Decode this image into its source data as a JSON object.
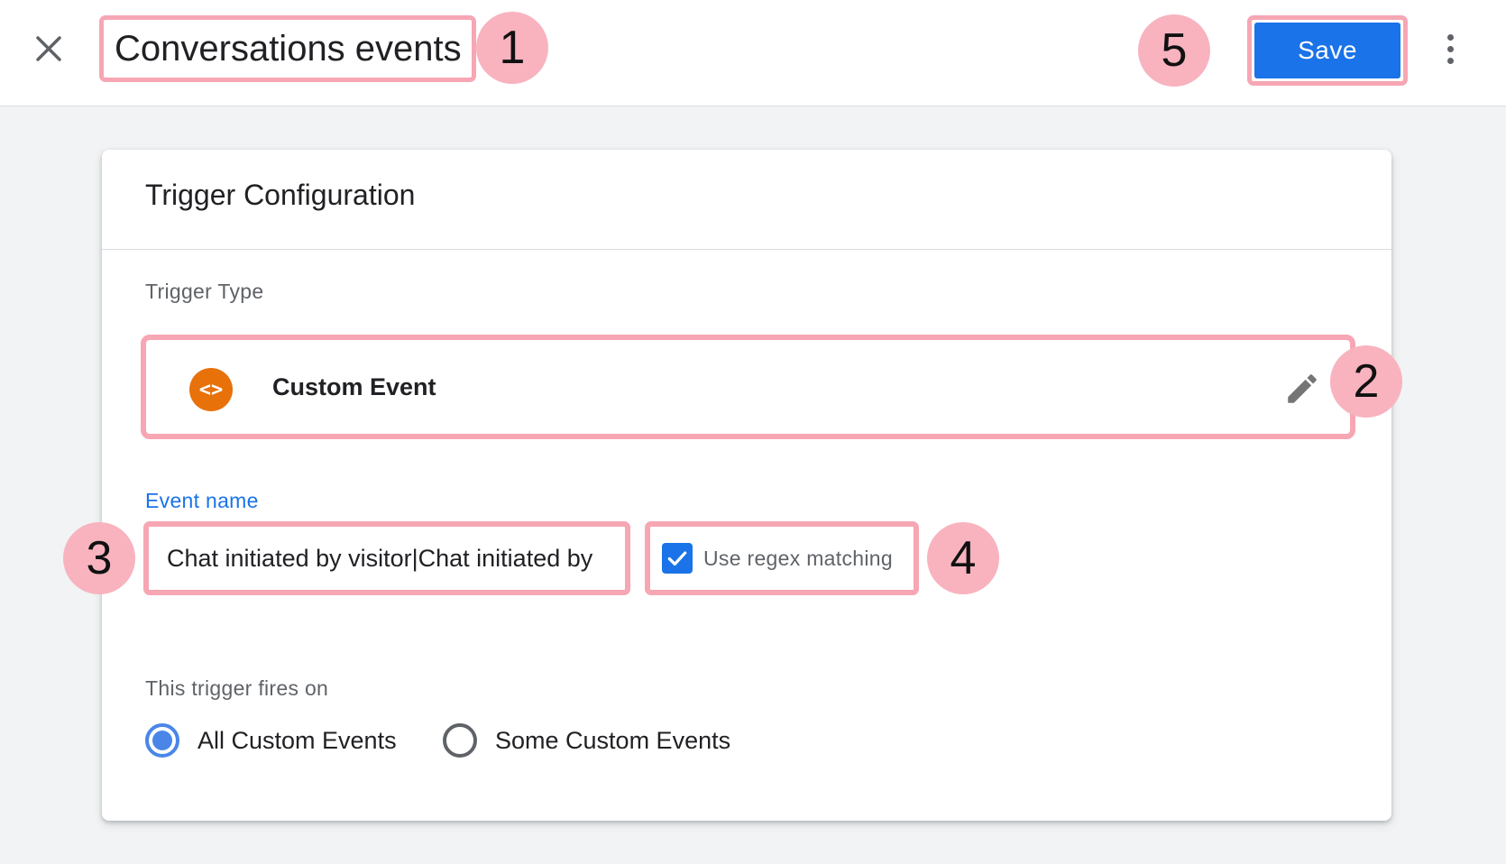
{
  "header": {
    "title_value": "Conversations events",
    "save_label": "Save",
    "close_icon": "close-icon",
    "more_icon": "more-vert-icon"
  },
  "annotations": [
    "1",
    "2",
    "3",
    "4",
    "5"
  ],
  "card": {
    "title": "Trigger Configuration",
    "trigger_type": {
      "label": "Trigger Type",
      "name": "Custom Event",
      "icon": "code-icon",
      "icon_glyph": "<>",
      "edit_icon": "pencil-icon"
    },
    "event_name": {
      "label": "Event name",
      "value": "Chat initiated by visitor|Chat initiated by"
    },
    "regex": {
      "label": "Use regex matching",
      "checked": true
    },
    "fires_on": {
      "label": "This trigger fires on",
      "options": [
        {
          "label": "All Custom Events",
          "selected": true
        },
        {
          "label": "Some Custom Events",
          "selected": false
        }
      ]
    }
  },
  "colors": {
    "accent": "#1a73e8",
    "annotation": "#f8b3bf",
    "trigger_icon": "#e8710a"
  }
}
